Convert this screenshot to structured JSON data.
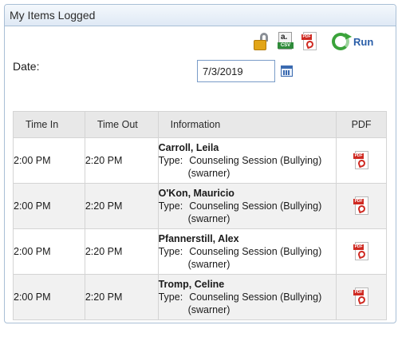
{
  "panel": {
    "title": "My Items Logged"
  },
  "toolbar": {
    "lock_icon": "unlocked-padlock-icon",
    "csv_icon": "csv-export-icon",
    "csv_glyph": "a.",
    "csv_tag": "CSV",
    "pdf_icon": "pdf-export-icon",
    "run_icon": "refresh-icon",
    "run_label": "Run"
  },
  "filter": {
    "date_label": "Date:",
    "date_value": "7/3/2019",
    "calendar_icon": "calendar-icon"
  },
  "table": {
    "headers": {
      "time_in": "Time In",
      "time_out": "Time Out",
      "information": "Information",
      "pdf": "PDF"
    },
    "rows": [
      {
        "time_in": "2:00 PM",
        "time_out": "2:20 PM",
        "name": "Carroll, Leila",
        "type_label": "Type:",
        "type": "Counseling Session (Bullying)",
        "user": "(swarner)"
      },
      {
        "time_in": "2:00 PM",
        "time_out": "2:20 PM",
        "name": "O'Kon, Mauricio",
        "type_label": "Type:",
        "type": "Counseling Session (Bullying)",
        "user": "(swarner)"
      },
      {
        "time_in": "2:00 PM",
        "time_out": "2:20 PM",
        "name": "Pfannerstill, Alex",
        "type_label": "Type:",
        "type": "Counseling Session (Bullying)",
        "user": "(swarner)"
      },
      {
        "time_in": "2:00 PM",
        "time_out": "2:20 PM",
        "name": "Tromp, Celine",
        "type_label": "Type:",
        "type": "Counseling Session (Bullying)",
        "user": "(swarner)"
      }
    ]
  },
  "pdf_label_text": "PDF",
  "colors": {
    "header_border": "#a9bfd6",
    "run_text": "#2a5ea8",
    "pdf_red": "#cf2a22",
    "csv_green": "#2f8b3a"
  }
}
